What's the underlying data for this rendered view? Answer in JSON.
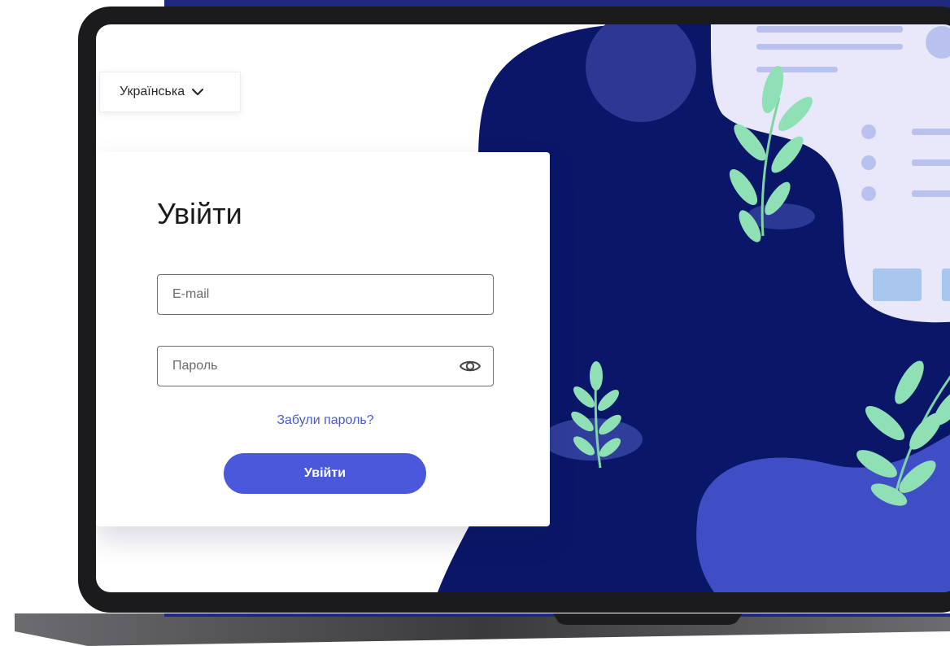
{
  "language_selector": {
    "selected": "Українська",
    "icon": "chevron-down-icon"
  },
  "login": {
    "title": "Увійти",
    "email_placeholder": "E-mail",
    "password_placeholder": "Пароль",
    "password_toggle_icon": "eye-icon",
    "forgot_password": "Забули пароль?",
    "submit_label": "Увійти"
  },
  "colors": {
    "accent": "#4a58db",
    "link": "#4a59d1",
    "illustration_dark": "#0a1667",
    "illustration_blob": "#3f4ec4",
    "leaf": "#8fe1b5",
    "laptop_frame": "#1b1b1d"
  }
}
